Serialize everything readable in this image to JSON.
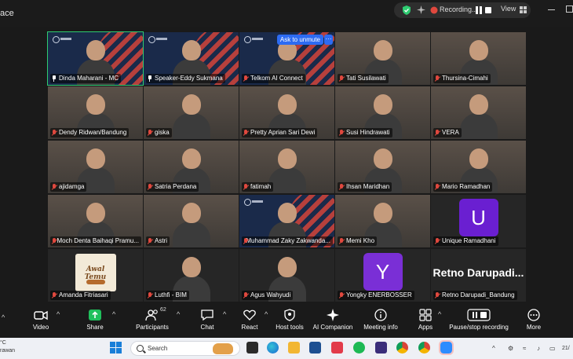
{
  "titlebar": {
    "app_title": "ace",
    "recording_label": "Recording...",
    "view_label": "View"
  },
  "tiles": [
    {
      "name": "Dinda Maharani - MC",
      "pinned": true,
      "bg": "brand"
    },
    {
      "name": "Speaker-Eddy Sukmana",
      "pinned": true,
      "bg": "brand"
    },
    {
      "name": "Telkom AI Connect",
      "bg": "brand",
      "ask_unmute": "Ask to unmute"
    },
    {
      "name": "Tati Susilawati",
      "bg": "img"
    },
    {
      "name": "Thursina-Cimahi",
      "bg": "img"
    },
    {
      "name": "Dendy Ridwan/Bandung",
      "bg": "img"
    },
    {
      "name": "giska",
      "bg": "img"
    },
    {
      "name": "Pretty Aprian Sari Dewi",
      "bg": "img"
    },
    {
      "name": "Susi Hindrawati",
      "bg": "img"
    },
    {
      "name": "VERA",
      "bg": "img"
    },
    {
      "name": "ajidamga",
      "bg": "img"
    },
    {
      "name": "Satria Perdana",
      "bg": "img"
    },
    {
      "name": "fatimah",
      "bg": "img"
    },
    {
      "name": "Ihsan Maridhan",
      "bg": "img"
    },
    {
      "name": "Mario Ramadhan",
      "bg": "img"
    },
    {
      "name": "Moch Denta Baihaqi Pramu...",
      "bg": "img"
    },
    {
      "name": "Astri",
      "bg": "img"
    },
    {
      "name": "Muhammad Zaky Zakwanda...",
      "bg": "brand"
    },
    {
      "name": "Memi Kho",
      "bg": "img"
    },
    {
      "name": "Unique Ramadhani",
      "bg": "dark",
      "letter": "U",
      "letter_color": "#6a1fd1"
    },
    {
      "name": "Amanda Fitriasari",
      "bg": "dark",
      "logo_text": "Awal Temu"
    },
    {
      "name": "Luthfi - BIM",
      "bg": "dark"
    },
    {
      "name": "Agus Wahyudi",
      "bg": "dark"
    },
    {
      "name": "Yongky ENERBOSSER",
      "bg": "dark",
      "letter": "Y",
      "letter_color": "#7a2fd6"
    },
    {
      "name": "Retno Darupadi_Bandung",
      "bg": "dark",
      "text_avatar": "Retno  Darupadi..."
    }
  ],
  "toolbar": {
    "items": [
      {
        "label": "Video",
        "icon": "video-camera-icon"
      },
      {
        "label": "Share",
        "icon": "share-screen-icon"
      },
      {
        "label": "Participants",
        "icon": "participants-icon",
        "count": "62"
      },
      {
        "label": "Chat",
        "icon": "chat-icon"
      },
      {
        "label": "React",
        "icon": "react-heart-icon"
      },
      {
        "label": "Host tools",
        "icon": "host-tools-shield-icon"
      },
      {
        "label": "AI Companion",
        "icon": "ai-companion-sparkle-icon"
      },
      {
        "label": "Meeting info",
        "icon": "meeting-info-icon"
      },
      {
        "label": "Apps",
        "icon": "apps-icon"
      },
      {
        "label": "Pause/stop recording",
        "icon": "pause-stop-recording-icon"
      },
      {
        "label": "More",
        "icon": "more-icon"
      }
    ]
  },
  "taskbar": {
    "weather_line1": "°C",
    "weather_line2": "rawan",
    "search_placeholder": "Search",
    "time": "21/"
  },
  "colors": {
    "speaking_border": "#2ecc71",
    "muted_mic": "#e0483e",
    "unmute_button": "#2d6bf2",
    "share_green": "#20c05c"
  }
}
